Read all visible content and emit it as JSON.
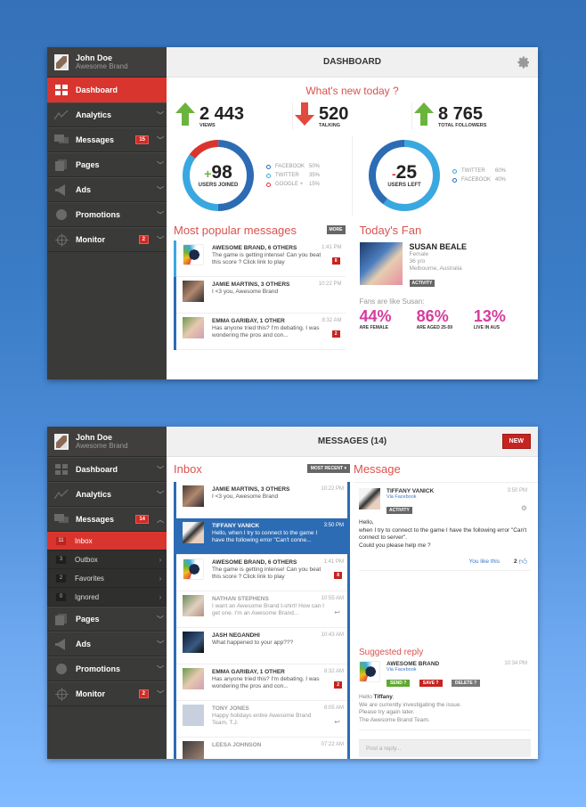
{
  "colors": {
    "accent_red": "#d9352f",
    "blue": "#2c6cb4",
    "light_blue": "#3aa8e0",
    "green": "#6ab43e",
    "pink": "#d63c9e",
    "sidebar": "#3a3a38"
  },
  "user": {
    "name": "John Doe",
    "brand": "Awesome Brand"
  },
  "dashboard": {
    "sidebar": [
      {
        "label": "Dashboard",
        "icon": "grid-icon",
        "active": true
      },
      {
        "label": "Analytics",
        "icon": "chart-line-icon"
      },
      {
        "label": "Messages",
        "icon": "chat-icon",
        "badge": "15"
      },
      {
        "label": "Pages",
        "icon": "pages-icon"
      },
      {
        "label": "Ads",
        "icon": "megaphone-icon"
      },
      {
        "label": "Promotions",
        "icon": "badge-icon"
      },
      {
        "label": "Monitor",
        "icon": "crosshair-icon",
        "badge": "2"
      }
    ],
    "title": "DASHBOARD",
    "whats_new": "What's new today ?",
    "stats": [
      {
        "value": "2 443",
        "label": "VIEWS",
        "trend": "up"
      },
      {
        "value": "520",
        "label": "TALKING",
        "trend": "down"
      },
      {
        "value": "8 765",
        "label": "TOTAL FOLLOWERS",
        "trend": "up"
      }
    ],
    "joined": {
      "sign": "+",
      "value": "98",
      "label": "USERS JOINED",
      "legend": [
        {
          "name": "FACEBOOK",
          "pct": "50%",
          "value": 50,
          "color": "#2c6cb4"
        },
        {
          "name": "TWITTER",
          "pct": "35%",
          "value": 35,
          "color": "#3aa8e0"
        },
        {
          "name": "GOOGLE +",
          "pct": "15%",
          "value": 15,
          "color": "#d9352f"
        }
      ]
    },
    "left": {
      "sign": "-",
      "value": "25",
      "label": "USERS LEFT",
      "legend": [
        {
          "name": "TWITTER",
          "pct": "60%",
          "value": 60,
          "color": "#3aa8e0"
        },
        {
          "name": "FACEBOOK",
          "pct": "40%",
          "value": 40,
          "color": "#2c6cb4"
        }
      ]
    },
    "popular_title": "Most popular messages",
    "more_label": "MORE",
    "popular": [
      {
        "from": "AWESOME BRAND, 6 OTHERS",
        "time": "1:41 PM",
        "text": "The game is getting intense! Can you beat this score ? Click link to play",
        "badge": "8",
        "avatar": "brand"
      },
      {
        "from": "JAMIE MARTINS, 3 OTHERS",
        "time": "10:22 PM",
        "text": "I <3 you, Awesome Brand",
        "avatar": "group"
      },
      {
        "from": "EMMA GARIBAY, 1 OTHER",
        "time": "8:32 AM",
        "text": "Has anyone tried this? I'm debating. I was wondering the pros and con...",
        "badge": "2",
        "avatar": "emma"
      }
    ],
    "fan_title": "Today's Fan",
    "fan": {
      "name": "SUSAN BEALE",
      "gender": "Female",
      "age": "36 y/o",
      "location": "Melbourne, Australia",
      "activity": "ACTIVITY"
    },
    "fans_like": "Fans are like Susan:",
    "pcts": [
      {
        "value": "44%",
        "label": "ARE FEMALE"
      },
      {
        "value": "86%",
        "label": "ARE AGED 25-59"
      },
      {
        "value": "13%",
        "label": "LIVE IN AUS"
      }
    ]
  },
  "messages": {
    "sidebar": [
      {
        "label": "Dashboard",
        "icon": "grid-icon"
      },
      {
        "label": "Analytics",
        "icon": "chart-line-icon"
      },
      {
        "label": "Messages",
        "icon": "chat-icon",
        "badge": "14",
        "open": true
      }
    ],
    "subnav": [
      {
        "label": "Inbox",
        "count": "11",
        "active": true
      },
      {
        "label": "Outbox",
        "count": "3"
      },
      {
        "label": "Favorites",
        "count": "2"
      },
      {
        "label": "Ignored",
        "count": "0"
      }
    ],
    "sidebar_rest": [
      {
        "label": "Pages",
        "icon": "pages-icon"
      },
      {
        "label": "Ads",
        "icon": "megaphone-icon"
      },
      {
        "label": "Promotions",
        "icon": "badge-icon"
      },
      {
        "label": "Monitor",
        "icon": "crosshair-icon",
        "badge": "2"
      }
    ],
    "title": "MESSAGES (14)",
    "new_label": "NEW",
    "inbox_title": "Inbox",
    "sort_label": "MOST RECENT ▾",
    "inbox": [
      {
        "from": "JAMIE MARTINS, 3 OTHERS",
        "time": "10:22 PM",
        "text": "I <3 you, Awesome Brand",
        "avatar": "group"
      },
      {
        "from": "TIFFANY VANICK",
        "time": "3:50 PM",
        "text": "Hello, when I try to connect to the game I have the following error \"Can't conne...",
        "avatar": "tiffany",
        "selected": true
      },
      {
        "from": "AWESOME BRAND, 6 OTHERS",
        "time": "1:41 PM",
        "text": "The game is getting intense! Can you beat this score ? Click link to play",
        "badge": "8",
        "avatar": "brand"
      },
      {
        "from": "NATHAN STEPHENS",
        "time": "10:55 AM",
        "text": "I want an Awesome Brand t-shirt! How can I get one. I'm an Awesome Brand...",
        "avatar": "nathan",
        "faded": true,
        "replied": true
      },
      {
        "from": "JASH NEGANDHI",
        "time": "10:43 AM",
        "text": "What happened to your app???",
        "avatar": "jash",
        "flag": "red"
      },
      {
        "from": "EMMA GARIBAY, 1 OTHER",
        "time": "8:32 AM",
        "text": "Has anyone tried this? I'm debating. I was wondering the pros and con...",
        "badge": "2",
        "avatar": "emma"
      },
      {
        "from": "TONY JONES",
        "time": "8:05 AM",
        "text": "Happy holidays entire Awesome Brand Team, T.J.",
        "avatar": "blank",
        "faded": true,
        "replied": true
      },
      {
        "from": "LEESA JOHNSON",
        "time": "07:22 AM",
        "text": "",
        "avatar": "leesa",
        "faded": true
      }
    ],
    "message_title": "Message",
    "message": {
      "from": "TIFFANY VANICK",
      "via": "Via Facebook",
      "activity": "ACTIVITY",
      "time": "3:50 PM",
      "body": [
        "Hello,",
        "when I try to connect to the game I have the following error \"Can't connect to server\".",
        "Could you please help me ?"
      ],
      "you_like": "You like this",
      "likes": "2"
    },
    "suggested_title": "Suggested reply",
    "reply": {
      "from": "AWESOME BRAND",
      "via": "Via Facebook",
      "time": "10:34 PM",
      "send": "SEND ?",
      "save": "SAVE ?",
      "delete": "DELETE ?",
      "greeting": "Hello ",
      "greeting_name": "Tiffany",
      "greeting_end": ",",
      "lines": [
        "We are currently investigating the issue.",
        "Please try again later.",
        "The Awesome Brand Team."
      ]
    },
    "post_placeholder": "Post a reply..."
  }
}
